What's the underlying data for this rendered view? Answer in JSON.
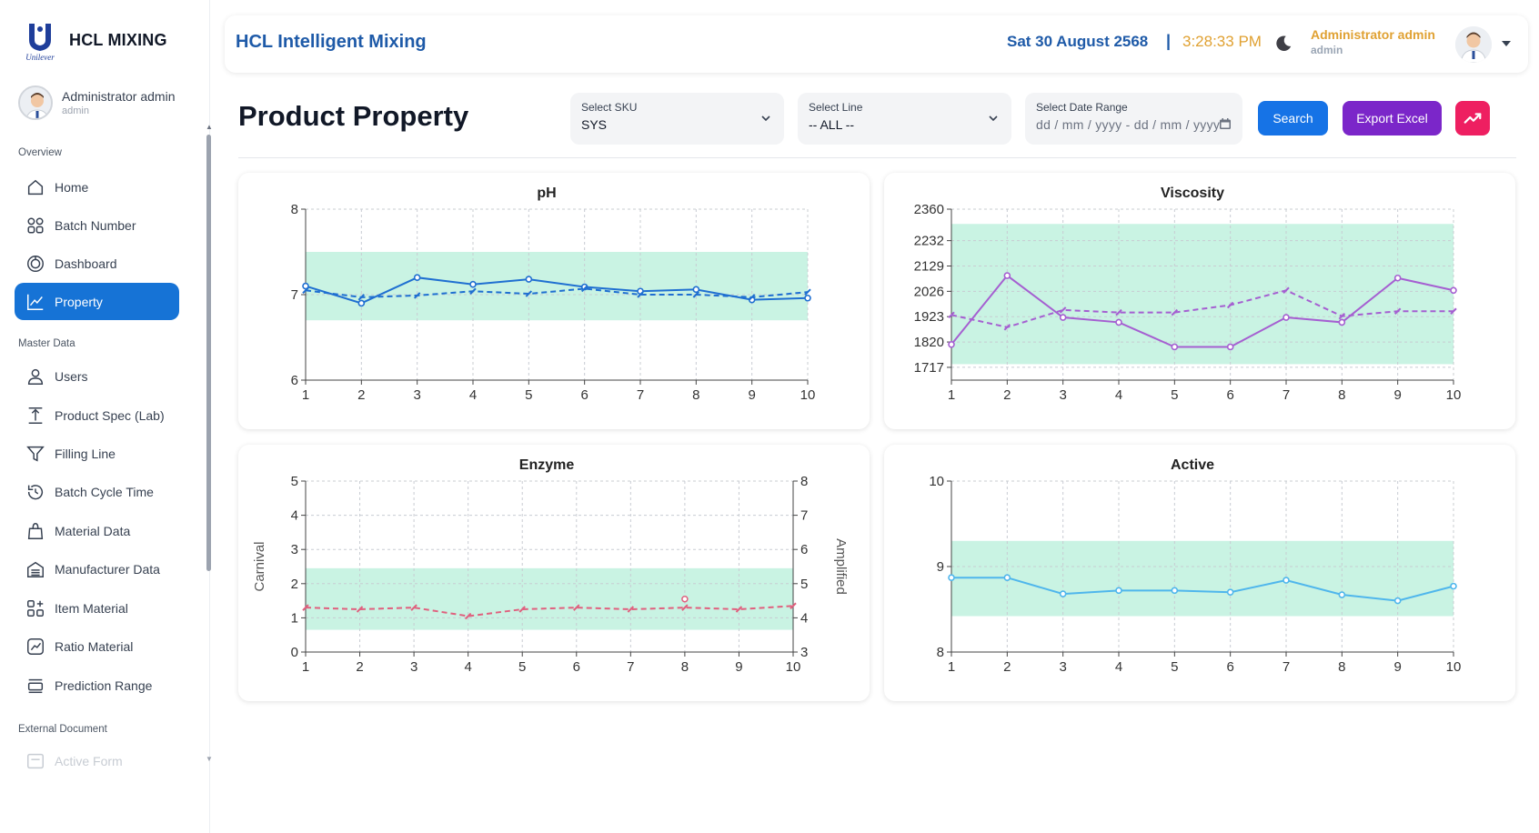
{
  "sidebar": {
    "brand": "HCL MIXING",
    "logo_text": "Unilever",
    "user_name": "Administrator admin",
    "user_role": "admin",
    "sections": {
      "overview": "Overview",
      "master_data": "Master Data",
      "external": "External Document"
    },
    "items": [
      {
        "label": "Home",
        "icon": "home-icon"
      },
      {
        "label": "Batch Number",
        "icon": "grid-icon"
      },
      {
        "label": "Dashboard",
        "icon": "dashboard-icon"
      },
      {
        "label": "Property",
        "icon": "line-chart-icon",
        "active": true
      },
      {
        "label": "Users",
        "icon": "user-icon"
      },
      {
        "label": "Product Spec (Lab)",
        "icon": "spec-icon"
      },
      {
        "label": "Filling Line",
        "icon": "filter-icon"
      },
      {
        "label": "Batch Cycle Time",
        "icon": "history-icon"
      },
      {
        "label": "Material Data",
        "icon": "bag-icon"
      },
      {
        "label": "Manufacturer Data",
        "icon": "factory-icon"
      },
      {
        "label": "Item Material",
        "icon": "grid-plus-icon"
      },
      {
        "label": "Ratio Material",
        "icon": "ratio-chart-icon"
      },
      {
        "label": "Prediction Range",
        "icon": "range-icon"
      },
      {
        "label": "Active Form",
        "icon": "form-icon"
      }
    ]
  },
  "header": {
    "app_title": "HCL Intelligent Mixing",
    "date": "Sat 30 August 2568",
    "separator": "|",
    "time": "3:28:33 PM",
    "user_name": "Administrator admin",
    "user_role": "admin"
  },
  "page": {
    "title": "Product Property",
    "filters": {
      "sku_label": "Select SKU",
      "sku_value": "SYS",
      "line_label": "Select Line",
      "line_value": "-- ALL --",
      "date_label": "Select Date Range",
      "date_placeholder": "dd / mm / yyyy  -  dd / mm / yyyy"
    },
    "buttons": {
      "search": "Search",
      "export": "Export Excel"
    }
  },
  "colors": {
    "accent": "#1673d6",
    "export": "#7b26c9",
    "trend": "#ee1f61",
    "band": "#c9f3e3",
    "ph": "#1f6fd1",
    "viscosity": "#a55fd1",
    "enzyme": "#e0607e",
    "active": "#4fb6ec"
  },
  "chart_data": [
    {
      "type": "line",
      "title": "pH",
      "x": [
        1,
        2,
        3,
        4,
        5,
        6,
        7,
        8,
        9,
        10
      ],
      "ylim": [
        6,
        8
      ],
      "yticks": [
        6,
        7,
        8
      ],
      "band": [
        6.7,
        7.5
      ],
      "grid": true,
      "series": [
        {
          "style": "solid",
          "values": [
            7.1,
            6.9,
            7.2,
            7.12,
            7.18,
            7.09,
            7.04,
            7.06,
            6.94,
            6.96
          ]
        },
        {
          "style": "dashed",
          "values": [
            7.05,
            6.97,
            6.99,
            7.04,
            7.01,
            7.07,
            7.0,
            7.0,
            6.97,
            7.03
          ]
        }
      ]
    },
    {
      "type": "line",
      "title": "Viscosity",
      "x": [
        1,
        2,
        3,
        4,
        5,
        6,
        7,
        8,
        9,
        10
      ],
      "ylim": [
        1665,
        2360
      ],
      "yticks": [
        1717,
        1820,
        1923,
        2026,
        2129,
        2232,
        2360
      ],
      "band": [
        1730,
        2300
      ],
      "grid": true,
      "series": [
        {
          "style": "solid",
          "values": [
            1810,
            2090,
            1920,
            1900,
            1800,
            1800,
            1920,
            1900,
            2080,
            2030
          ]
        },
        {
          "style": "dashed",
          "values": [
            1930,
            1880,
            1950,
            1940,
            1940,
            1970,
            2030,
            1925,
            1945,
            1945
          ]
        }
      ]
    },
    {
      "type": "line",
      "title": "Enzyme",
      "x": [
        1,
        2,
        3,
        4,
        5,
        6,
        7,
        8,
        9,
        10
      ],
      "ylim": [
        0,
        5
      ],
      "yticks": [
        0,
        1,
        2,
        3,
        4,
        5
      ],
      "ylabel": "Carnival",
      "y2lim": [
        3,
        8
      ],
      "y2ticks": [
        3,
        4,
        5,
        6,
        7,
        8
      ],
      "y2label": "Amplified",
      "band": [
        0.65,
        2.45
      ],
      "grid": true,
      "series": [
        {
          "style": "dashed",
          "values": [
            1.3,
            1.25,
            1.3,
            1.05,
            1.25,
            1.3,
            1.25,
            1.3,
            1.25,
            1.35
          ]
        },
        {
          "style": "point",
          "values": [
            null,
            null,
            null,
            null,
            null,
            null,
            null,
            1.55,
            null,
            null
          ]
        }
      ]
    },
    {
      "type": "line",
      "title": "Active",
      "x": [
        1,
        2,
        3,
        4,
        5,
        6,
        7,
        8,
        9,
        10
      ],
      "ylim": [
        8,
        10
      ],
      "yticks": [
        8,
        9,
        10
      ],
      "band": [
        8.42,
        9.3
      ],
      "grid": true,
      "series": [
        {
          "style": "solid",
          "values": [
            8.87,
            8.87,
            8.68,
            8.72,
            8.72,
            8.7,
            8.84,
            8.67,
            8.6,
            8.77
          ]
        }
      ]
    }
  ]
}
